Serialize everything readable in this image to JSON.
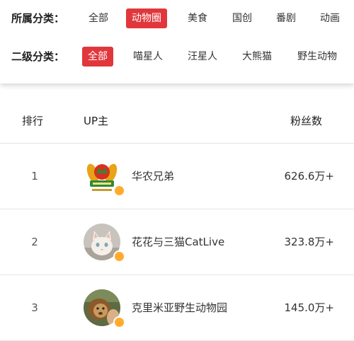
{
  "filters": {
    "category_label": "所属分类：",
    "category_options": [
      "全部",
      "动物圈",
      "美食",
      "国创",
      "番剧",
      "动画"
    ],
    "category_active": "动物圈",
    "sub_label": "二级分类：",
    "sub_options": [
      "全部",
      "喵星人",
      "汪星人",
      "大熊猫",
      "野生动物"
    ],
    "sub_active": "全部",
    "active_color": "#e1373c"
  },
  "table": {
    "headers": {
      "rank": "排行",
      "up": "UP主",
      "fans": "粉丝数"
    },
    "rows": [
      {
        "rank": "1",
        "name": "华农兄弟",
        "fans": "626.6万+",
        "avatar_icon": "huanong-logo-avatar-icon"
      },
      {
        "rank": "2",
        "name": "花花与三猫CatLive",
        "fans": "323.8万+",
        "avatar_icon": "cat-photo-avatar-icon"
      },
      {
        "rank": "3",
        "name": "克里米亚野生动物园",
        "fans": "145.0万+",
        "avatar_icon": "lion-photo-avatar-icon"
      }
    ],
    "badge_color": "#ffab2d"
  }
}
